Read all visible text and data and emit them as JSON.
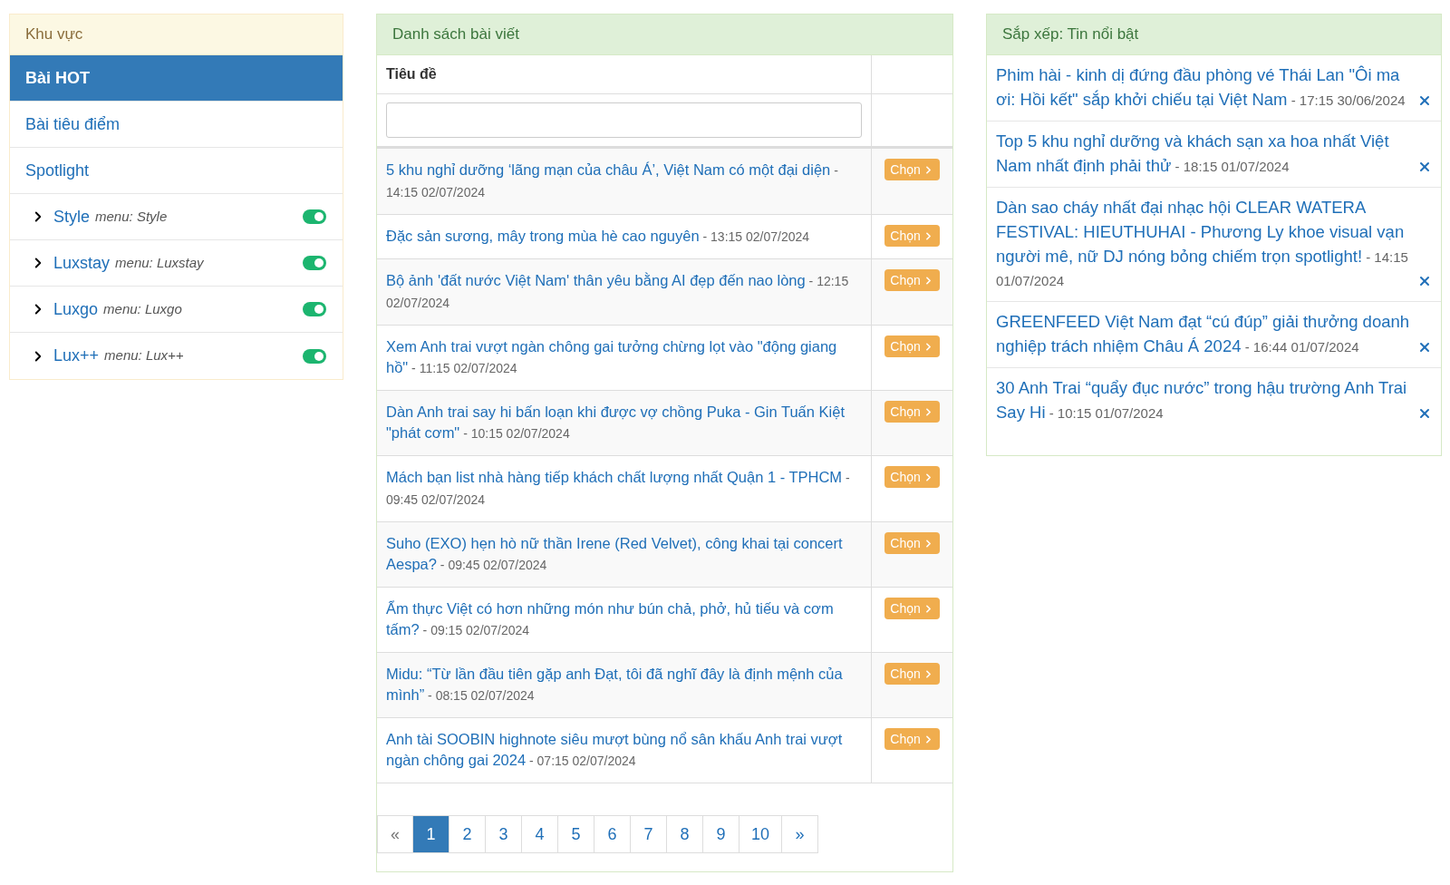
{
  "sidebar": {
    "title": "Khu vực",
    "items": [
      {
        "kind": "link",
        "label": "Bài HOT",
        "selected": true
      },
      {
        "kind": "link",
        "label": "Bài tiêu điểm",
        "selected": false
      },
      {
        "kind": "link",
        "label": "Spotlight",
        "selected": false
      },
      {
        "kind": "menu",
        "label": "Style",
        "menu_label": "menu: Style",
        "on": true
      },
      {
        "kind": "menu",
        "label": "Luxstay",
        "menu_label": "menu: Luxstay",
        "on": true
      },
      {
        "kind": "menu",
        "label": "Luxgo",
        "menu_label": "menu: Luxgo",
        "on": true
      },
      {
        "kind": "menu",
        "label": "Lux++",
        "menu_label": "menu: Lux++",
        "on": true
      }
    ]
  },
  "articles": {
    "title": "Danh sách bài viết",
    "column_title": "Tiêu đề",
    "rows": [
      {
        "title": "5 khu nghỉ dưỡng ‘lãng mạn của châu Á’, Việt Nam có một đại diện",
        "time": "- 14:15 02/07/2024",
        "choose_label": "Chọn"
      },
      {
        "title": "Đặc sản sương, mây trong mùa hè cao nguyên",
        "time": "- 13:15 02/07/2024",
        "choose_label": "Chọn"
      },
      {
        "title": "Bộ ảnh 'đất nước Việt Nam' thân yêu bằng AI đẹp đến nao lòng",
        "time": "- 12:15 02/07/2024",
        "choose_label": "Chọn"
      },
      {
        "title": "Xem Anh trai vượt ngàn chông gai tưởng chừng lọt vào \"động giang hồ\"",
        "time": "- 11:15 02/07/2024",
        "choose_label": "Chọn"
      },
      {
        "title": "Dàn Anh trai say hi bấn loạn khi được vợ chồng Puka - Gin Tuấn Kiệt \"phát cơm\"",
        "time": "- 10:15 02/07/2024",
        "choose_label": "Chọn"
      },
      {
        "title": "Mách bạn list nhà hàng tiếp khách chất lượng nhất Quận 1 - TPHCM",
        "time": "- 09:45 02/07/2024",
        "choose_label": "Chọn"
      },
      {
        "title": "Suho (EXO) hẹn hò nữ thần Irene (Red Velvet), công khai tại concert Aespa?",
        "time": "- 09:45 02/07/2024",
        "choose_label": "Chọn"
      },
      {
        "title": "Ẩm thực Việt có hơn những món như bún chả, phở, hủ tiếu và cơm tấm?",
        "time": "- 09:15 02/07/2024",
        "choose_label": "Chọn"
      },
      {
        "title": "Midu: “Từ lần đầu tiên gặp anh Đạt, tôi đã nghĩ đây là định mệnh của mình”",
        "time": "- 08:15 02/07/2024",
        "choose_label": "Chọn"
      },
      {
        "title": "Anh tài SOOBIN highnote siêu mượt bùng nổ sân khấu Anh trai vượt ngàn chông gai 2024",
        "time": "- 07:15 02/07/2024",
        "choose_label": "Chọn"
      }
    ],
    "pagination": {
      "prev": "«",
      "next": "»",
      "prev_disabled": true,
      "pages": [
        {
          "label": "1",
          "selected": true
        },
        {
          "label": "2",
          "selected": false
        },
        {
          "label": "3",
          "selected": false
        },
        {
          "label": "4",
          "selected": false
        },
        {
          "label": "5",
          "selected": false
        },
        {
          "label": "6",
          "selected": false
        },
        {
          "label": "7",
          "selected": false
        },
        {
          "label": "8",
          "selected": false
        },
        {
          "label": "9",
          "selected": false
        },
        {
          "label": "10",
          "selected": false
        }
      ]
    }
  },
  "featured": {
    "title": "Sắp xếp: Tin nổi bật",
    "items": [
      {
        "title": "Phim hài - kinh dị đứng đầu phòng vé Thái Lan \"Ôi ma ơi: Hồi kết\" sắp khởi chiếu tại Việt Nam",
        "time": "- 17:15 30/06/2024"
      },
      {
        "title": "Top 5 khu nghỉ dưỡng và khách sạn xa hoa nhất Việt Nam nhất định phải thử",
        "time": "- 18:15 01/07/2024"
      },
      {
        "title": "Dàn sao cháy nhất đại nhạc hội CLEAR WATERA FESTIVAL: HIEUTHUHAI - Phương Ly khoe visual vạn người mê, nữ DJ nóng bỏng chiếm trọn spotlight!",
        "time": "- 14:15 01/07/2024"
      },
      {
        "title": "GREENFEED Việt Nam đạt “cú đúp” giải thưởng doanh nghiệp trách nhiệm Châu Á 2024",
        "time": "- 16:44 01/07/2024"
      },
      {
        "title": "30 Anh Trai “quẩy đục nước” trong hậu trường Anh Trai Say Hi",
        "time": "- 10:15 01/07/2024"
      }
    ]
  }
}
